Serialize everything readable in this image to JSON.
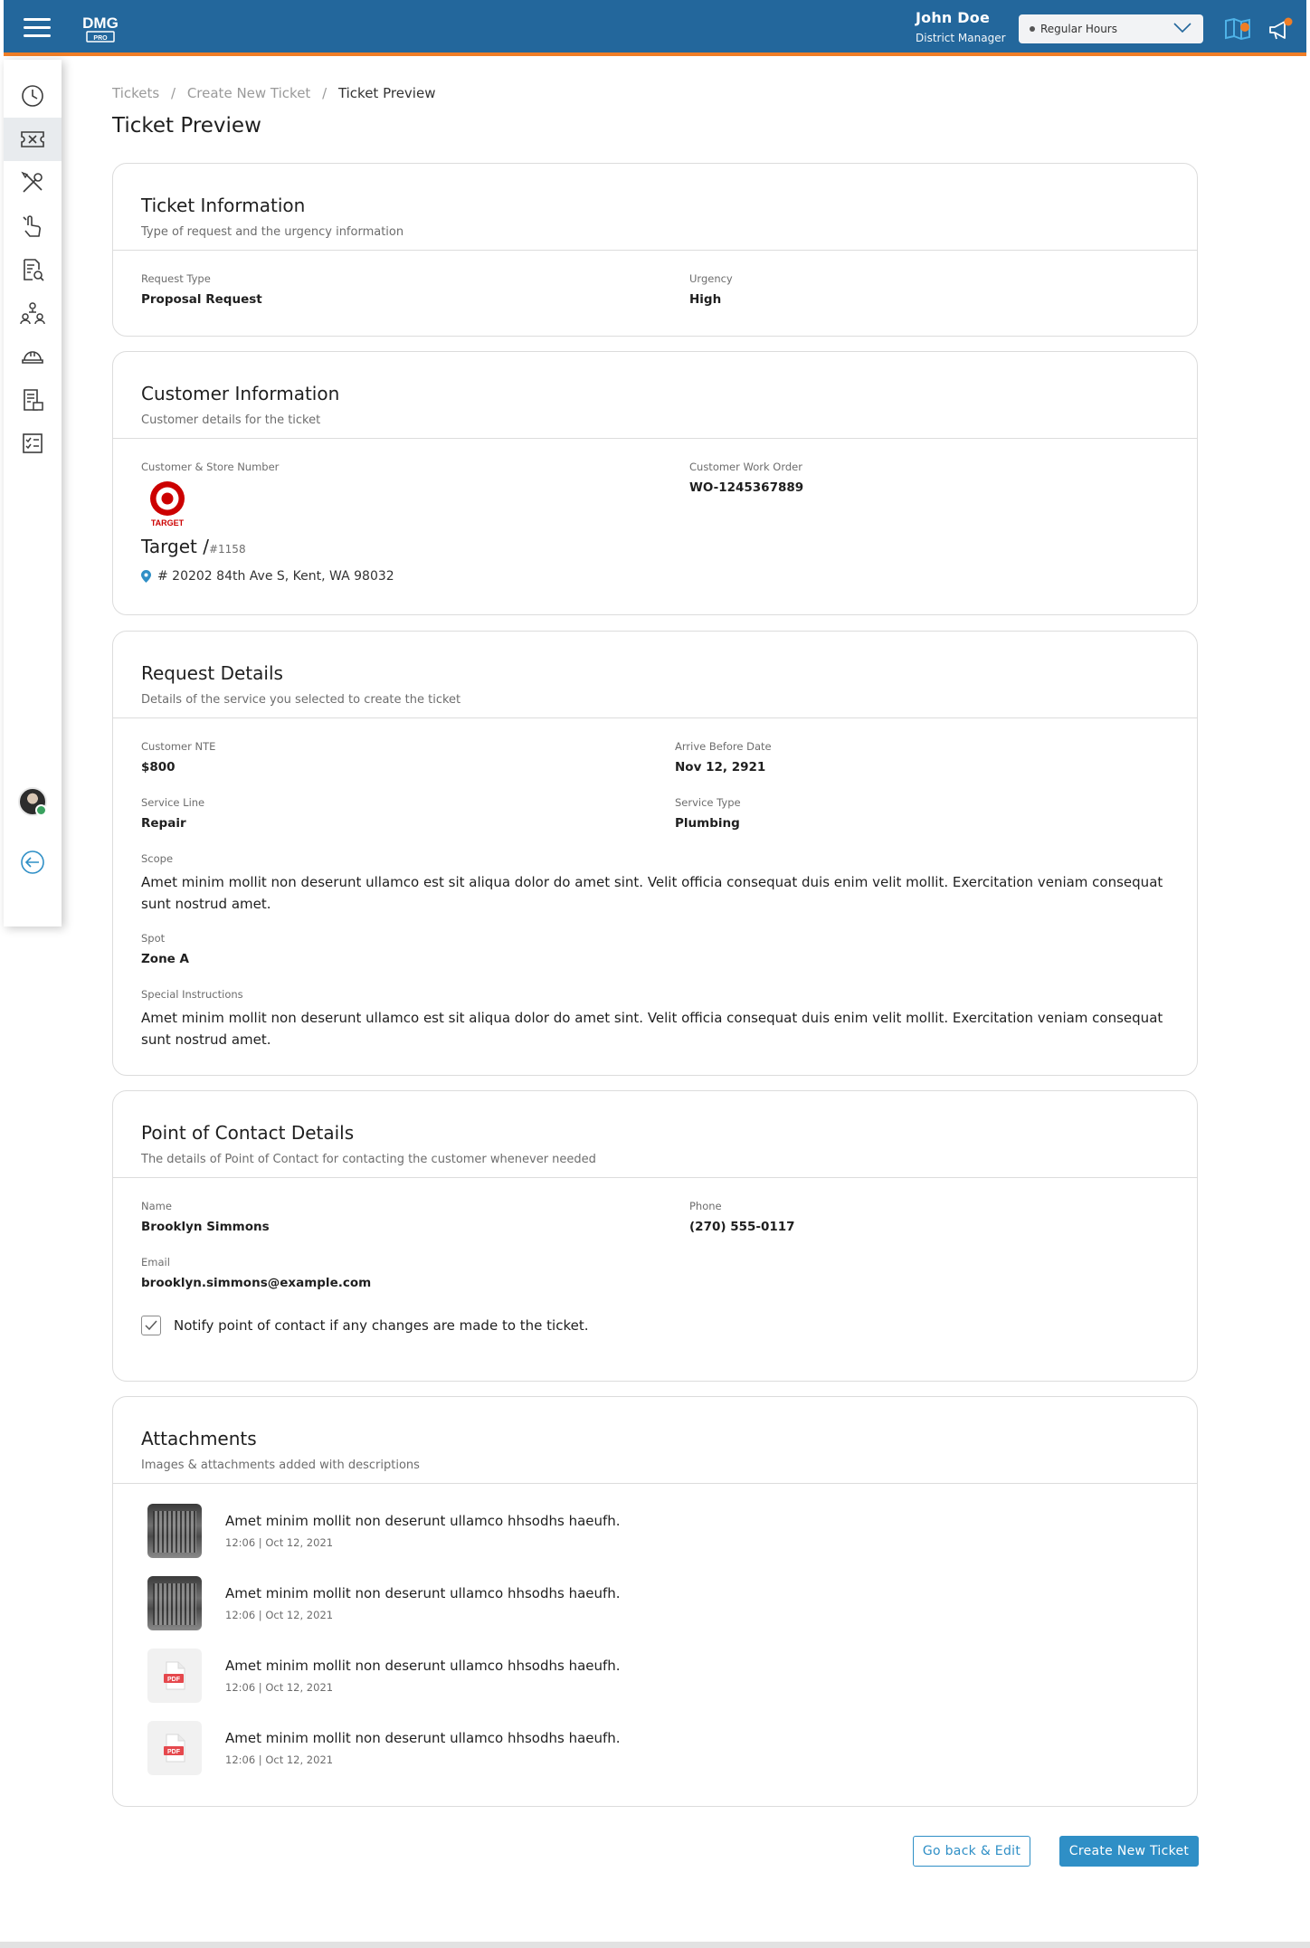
{
  "header": {
    "logo_text": "DMG",
    "logo_sub": "PRO",
    "user_name": "John Doe",
    "user_role": "District Manager",
    "hours_select": {
      "selected": "Regular Hours"
    },
    "colors": {
      "header_bg": "#23679c",
      "accent": "#f07e26",
      "primary": "#2f8fc6"
    }
  },
  "sidebar": {
    "items": [
      {
        "icon": "clock-icon"
      },
      {
        "icon": "ticket-icon",
        "active": true
      },
      {
        "icon": "tools-icon"
      },
      {
        "icon": "hand-tap-icon"
      },
      {
        "icon": "document-search-icon"
      },
      {
        "icon": "team-hierarchy-icon"
      },
      {
        "icon": "hard-hat-icon"
      },
      {
        "icon": "invoice-icon"
      },
      {
        "icon": "checklist-icon"
      }
    ],
    "bottom": [
      {
        "icon": "avatar"
      },
      {
        "icon": "logout-icon"
      }
    ]
  },
  "breadcrumb": {
    "items": [
      "Tickets",
      "Create New Ticket"
    ],
    "separator": "/",
    "current": "Ticket Preview"
  },
  "page_title": "Ticket Preview",
  "ticket_info": {
    "title": "Ticket Information",
    "subtitle": "Type of request and the urgency information",
    "request_type_label": "Request Type",
    "request_type": "Proposal Request",
    "urgency_label": "Urgency",
    "urgency": "High"
  },
  "customer_info": {
    "title": "Customer Information",
    "subtitle": "Customer details for the ticket",
    "store_label": "Customer & Store Number",
    "logo_text": "TARGET",
    "store_name": "Target /",
    "store_number": "#1158",
    "address": "# 20202 84th Ave S, Kent, WA 98032",
    "work_order_label": "Customer Work Order",
    "work_order": "WO-1245367889"
  },
  "request_details": {
    "title": "Request Details",
    "subtitle": "Details of the service you selected to create the ticket",
    "nte_label": "Customer NTE",
    "nte": "$800",
    "arrive_label": "Arrive Before Date",
    "arrive": "Nov 12, 2921",
    "service_line_label": "Service Line",
    "service_line": "Repair",
    "service_type_label": "Service Type",
    "service_type": "Plumbing",
    "scope_label": "Scope",
    "scope": "Amet minim mollit non deserunt ullamco est sit aliqua dolor do amet sint. Velit officia consequat duis enim velit mollit. Exercitation veniam consequat sunt nostrud amet.",
    "spot_label": "Spot",
    "spot": "Zone A",
    "special_label": "Special Instructions",
    "special": "Amet minim mollit non deserunt ullamco est sit aliqua dolor do amet sint. Velit officia consequat duis enim velit mollit. Exercitation veniam consequat sunt nostrud amet."
  },
  "contact": {
    "title": "Point of Contact Details",
    "subtitle": "The details of Point of Contact for contacting the customer whenever needed",
    "name_label": "Name",
    "name": "Brooklyn Simmons",
    "phone_label": "Phone",
    "phone": "(270) 555-0117",
    "email_label": "Email",
    "email": "brooklyn.simmons@example.com",
    "notify_label": "Notify point of contact if any changes are made to the ticket.",
    "notify_checked": true
  },
  "attachments": {
    "title": "Attachments",
    "subtitle": "Images & attachments added with descriptions",
    "pdf_badge": "PDF",
    "items": [
      {
        "kind": "image",
        "title": "Amet minim mollit non deserunt ullamco hhsodhs haeufh.",
        "meta": "12:06 | Oct 12, 2021"
      },
      {
        "kind": "image",
        "title": "Amet minim mollit non deserunt ullamco hhsodhs haeufh.",
        "meta": "12:06 | Oct 12, 2021"
      },
      {
        "kind": "pdf",
        "title": "Amet minim mollit non deserunt ullamco hhsodhs haeufh.",
        "meta": "12:06 | Oct 12, 2021"
      },
      {
        "kind": "pdf",
        "title": "Amet minim mollit non deserunt ullamco hhsodhs haeufh.",
        "meta": "12:06 | Oct 12, 2021"
      }
    ]
  },
  "actions": {
    "back_label": "Go back & Edit",
    "create_label": "Create New Ticket"
  }
}
